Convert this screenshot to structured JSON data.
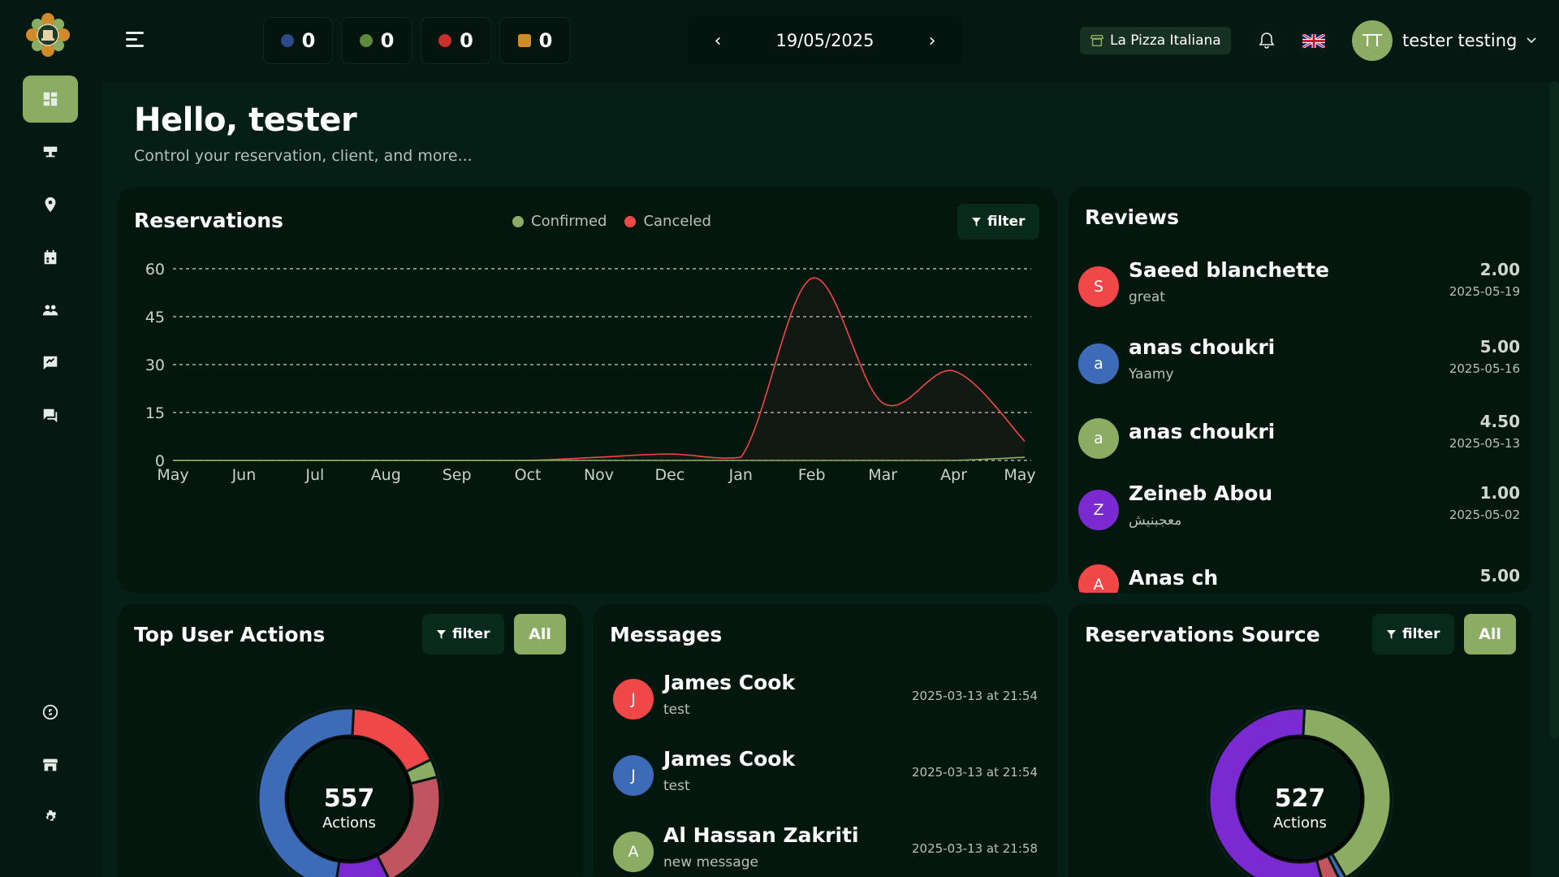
{
  "topbar": {
    "counters": [
      {
        "icon": "pending-icon",
        "value": "0",
        "color": "#2b4b8a"
      },
      {
        "icon": "confirmed-icon",
        "value": "0",
        "color": "#5b8a3b"
      },
      {
        "icon": "canceled-icon",
        "value": "0",
        "color": "#c9302c"
      },
      {
        "icon": "walk-in-icon",
        "value": "0",
        "color": "#d08a27"
      }
    ],
    "date": "19/05/2025",
    "restaurant": "La Pizza Italiana",
    "user": {
      "initials": "TT",
      "name": "tester testing"
    }
  },
  "sidebar": {
    "items": [
      "dashboard-icon",
      "tables-icon",
      "location-icon",
      "calendar-icon",
      "clients-icon",
      "reviews-icon",
      "messages-icon"
    ],
    "bottom_items": [
      "support-icon",
      "store-icon",
      "settings-icon"
    ]
  },
  "greeting": {
    "title": "Hello, tester",
    "subtitle": "Control your reservation, client, and more..."
  },
  "reservations": {
    "title": "Reservations",
    "filter_label": "filter",
    "legend": [
      {
        "label": "Confirmed",
        "color": "#8aad63"
      },
      {
        "label": "Canceled",
        "color": "#f04848"
      }
    ]
  },
  "chart_data": {
    "type": "line",
    "categories": [
      "May",
      "Jun",
      "Jul",
      "Aug",
      "Sep",
      "Oct",
      "Nov",
      "Dec",
      "Jan",
      "Feb",
      "Mar",
      "Apr",
      "May"
    ],
    "series": [
      {
        "name": "Confirmed",
        "color": "#8aad63",
        "values": [
          0,
          0,
          0,
          0,
          0,
          0,
          0,
          0,
          0,
          0,
          0,
          0,
          1
        ]
      },
      {
        "name": "Canceled",
        "color": "#f04848",
        "values": [
          0,
          0,
          0,
          0,
          0,
          0,
          1,
          2,
          1,
          57,
          18,
          28,
          6
        ]
      }
    ],
    "yticks": [
      0,
      15,
      30,
      45,
      60
    ],
    "ylim": [
      0,
      60
    ],
    "grid": true,
    "legend_position": "top"
  },
  "reviews": {
    "title": "Reviews",
    "items": [
      {
        "initial": "S",
        "name": "Saeed blanchette",
        "comment": "great",
        "rating": "2.00",
        "date": "2025-05-19",
        "color": "#f04848"
      },
      {
        "initial": "a",
        "name": "anas choukri",
        "comment": "Yaamy",
        "rating": "5.00",
        "date": "2025-05-16",
        "color": "#3e6bb8"
      },
      {
        "initial": "a",
        "name": "anas choukri",
        "comment": "",
        "rating": "4.50",
        "date": "2025-05-13",
        "color": "#8aad63"
      },
      {
        "initial": "Z",
        "name": "Zeineb Abou",
        "comment": "معجبنيش",
        "rating": "1.00",
        "date": "2025-05-02",
        "color": "#7a2ad0"
      },
      {
        "initial": "A",
        "name": "Anas ch",
        "comment": "",
        "rating": "5.00",
        "date": "",
        "color": "#f04848"
      }
    ]
  },
  "top_actions": {
    "title": "Top User Actions",
    "filter_label": "filter",
    "all_label": "All",
    "total": "557",
    "unit": "Actions",
    "segments": [
      {
        "value": 95,
        "color": "#f04848"
      },
      {
        "value": 18,
        "color": "#8aad63"
      },
      {
        "value": 120,
        "color": "#c0555f"
      },
      {
        "value": 55,
        "color": "#7a2ad0"
      },
      {
        "value": 269,
        "color": "#3e6bb8"
      }
    ]
  },
  "messages": {
    "title": "Messages",
    "items": [
      {
        "initial": "J",
        "name": "James Cook",
        "text": "test",
        "date": "2025-03-13 at 21:54",
        "color": "#f04848"
      },
      {
        "initial": "J",
        "name": "James Cook",
        "text": "test",
        "date": "2025-03-13 at 21:54",
        "color": "#3e6bb8"
      },
      {
        "initial": "A",
        "name": "Al Hassan Zakriti",
        "text": "new message",
        "date": "2025-03-13 at 21:58",
        "color": "#8aad63"
      }
    ]
  },
  "reservation_source": {
    "title": "Reservations Source",
    "filter_label": "filter",
    "all_label": "All",
    "total": "527",
    "unit": "Actions",
    "segments": [
      {
        "value": 215,
        "color": "#8aad63"
      },
      {
        "value": 6,
        "color": "#3e6bb8"
      },
      {
        "value": 16,
        "color": "#c0555f"
      },
      {
        "value": 290,
        "color": "#7a2ad0"
      }
    ]
  }
}
